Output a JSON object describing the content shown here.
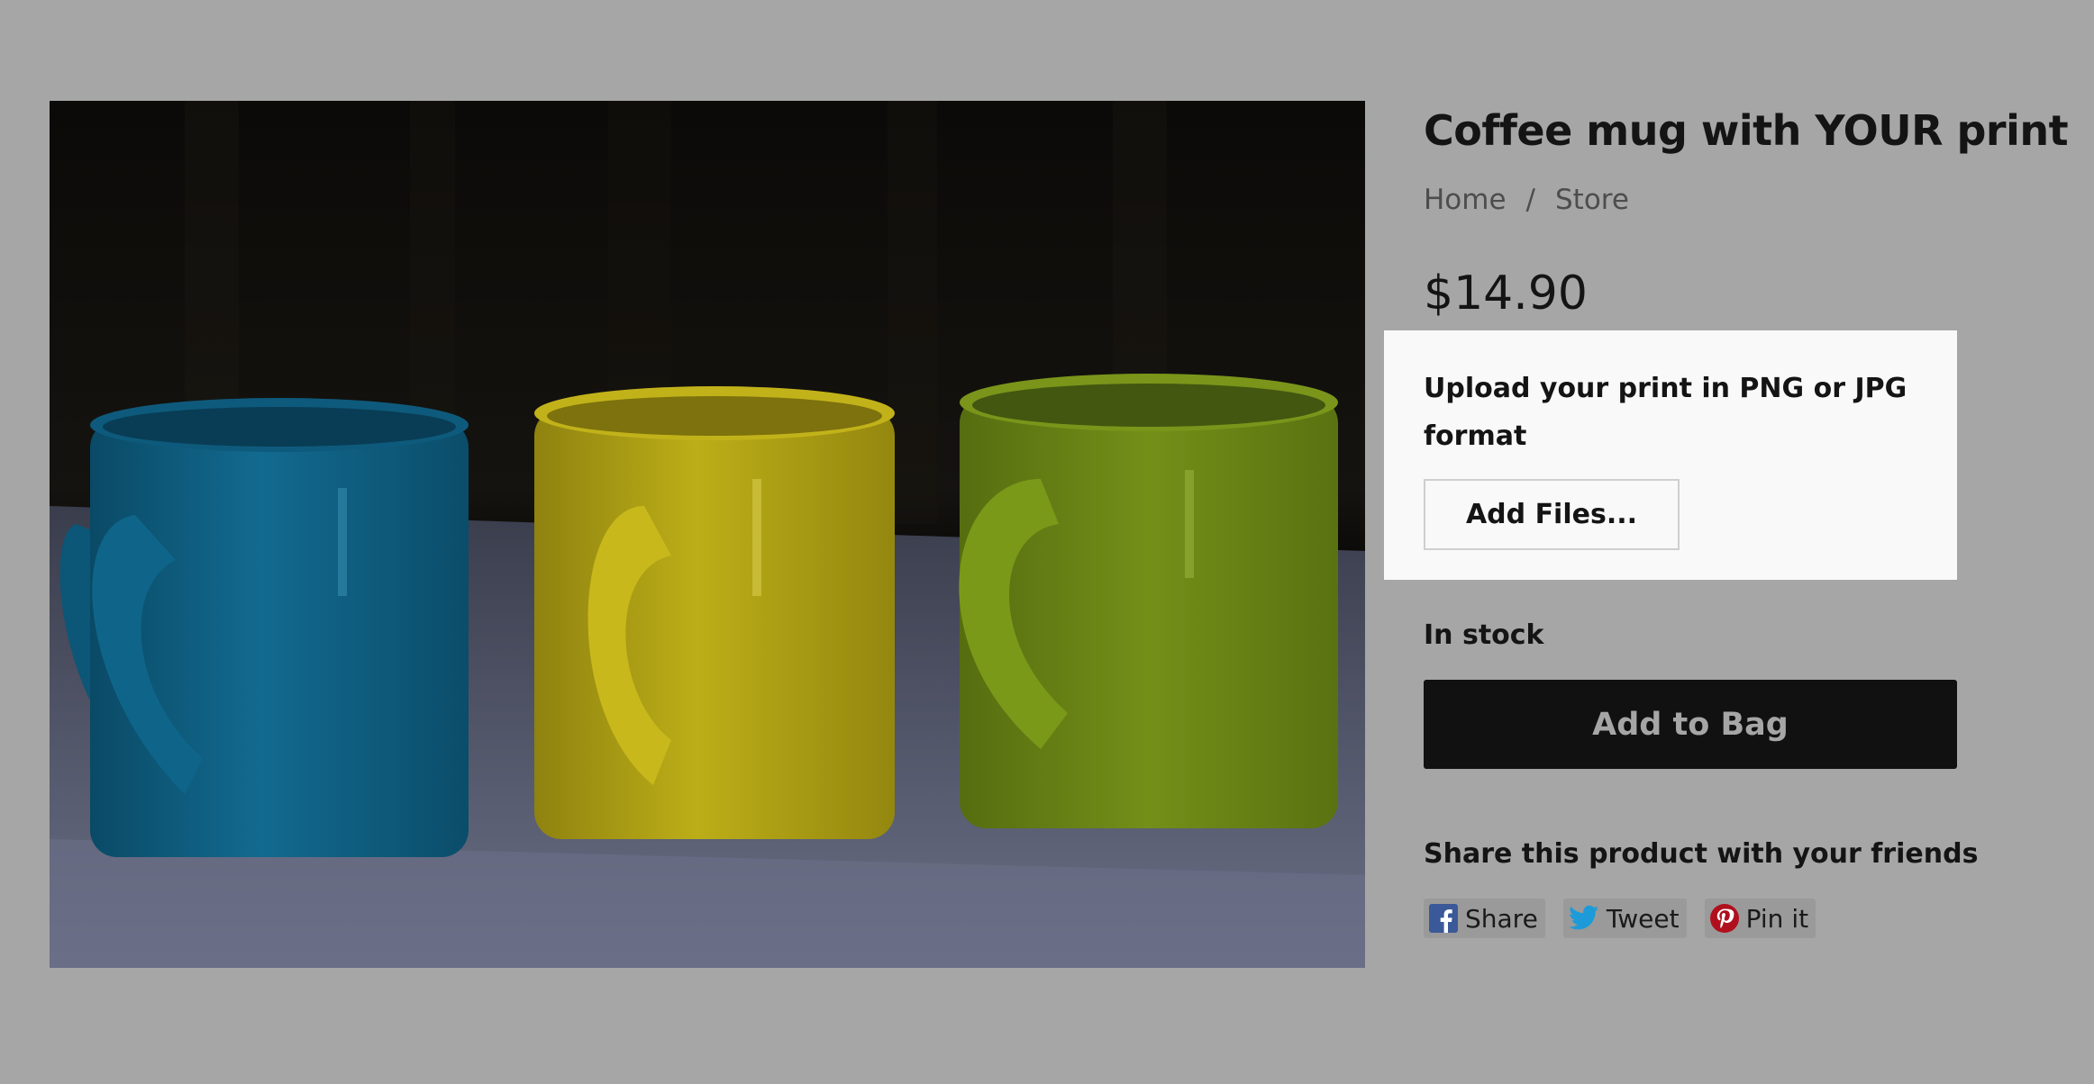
{
  "product": {
    "title": "Coffee mug with YOUR print",
    "price": "$14.90",
    "stock_status": "In stock"
  },
  "breadcrumb": {
    "items": [
      "Home",
      "Store"
    ],
    "separator": "/"
  },
  "upload": {
    "label": "Upload your print in PNG or JPG format",
    "button_label": "Add Files..."
  },
  "cart": {
    "add_label": "Add to Bag"
  },
  "share": {
    "heading": "Share this product with your friends",
    "buttons": [
      {
        "label": "Share",
        "icon": "facebook-icon",
        "color": "#3b5998"
      },
      {
        "label": "Tweet",
        "icon": "twitter-icon",
        "color": "#1d9bd8"
      },
      {
        "label": "Pin it",
        "icon": "pinterest-icon",
        "color": "#b0101d"
      }
    ]
  },
  "image": {
    "mug_colors": [
      "#0f5f82",
      "#b9a914",
      "#6f8a16"
    ]
  }
}
